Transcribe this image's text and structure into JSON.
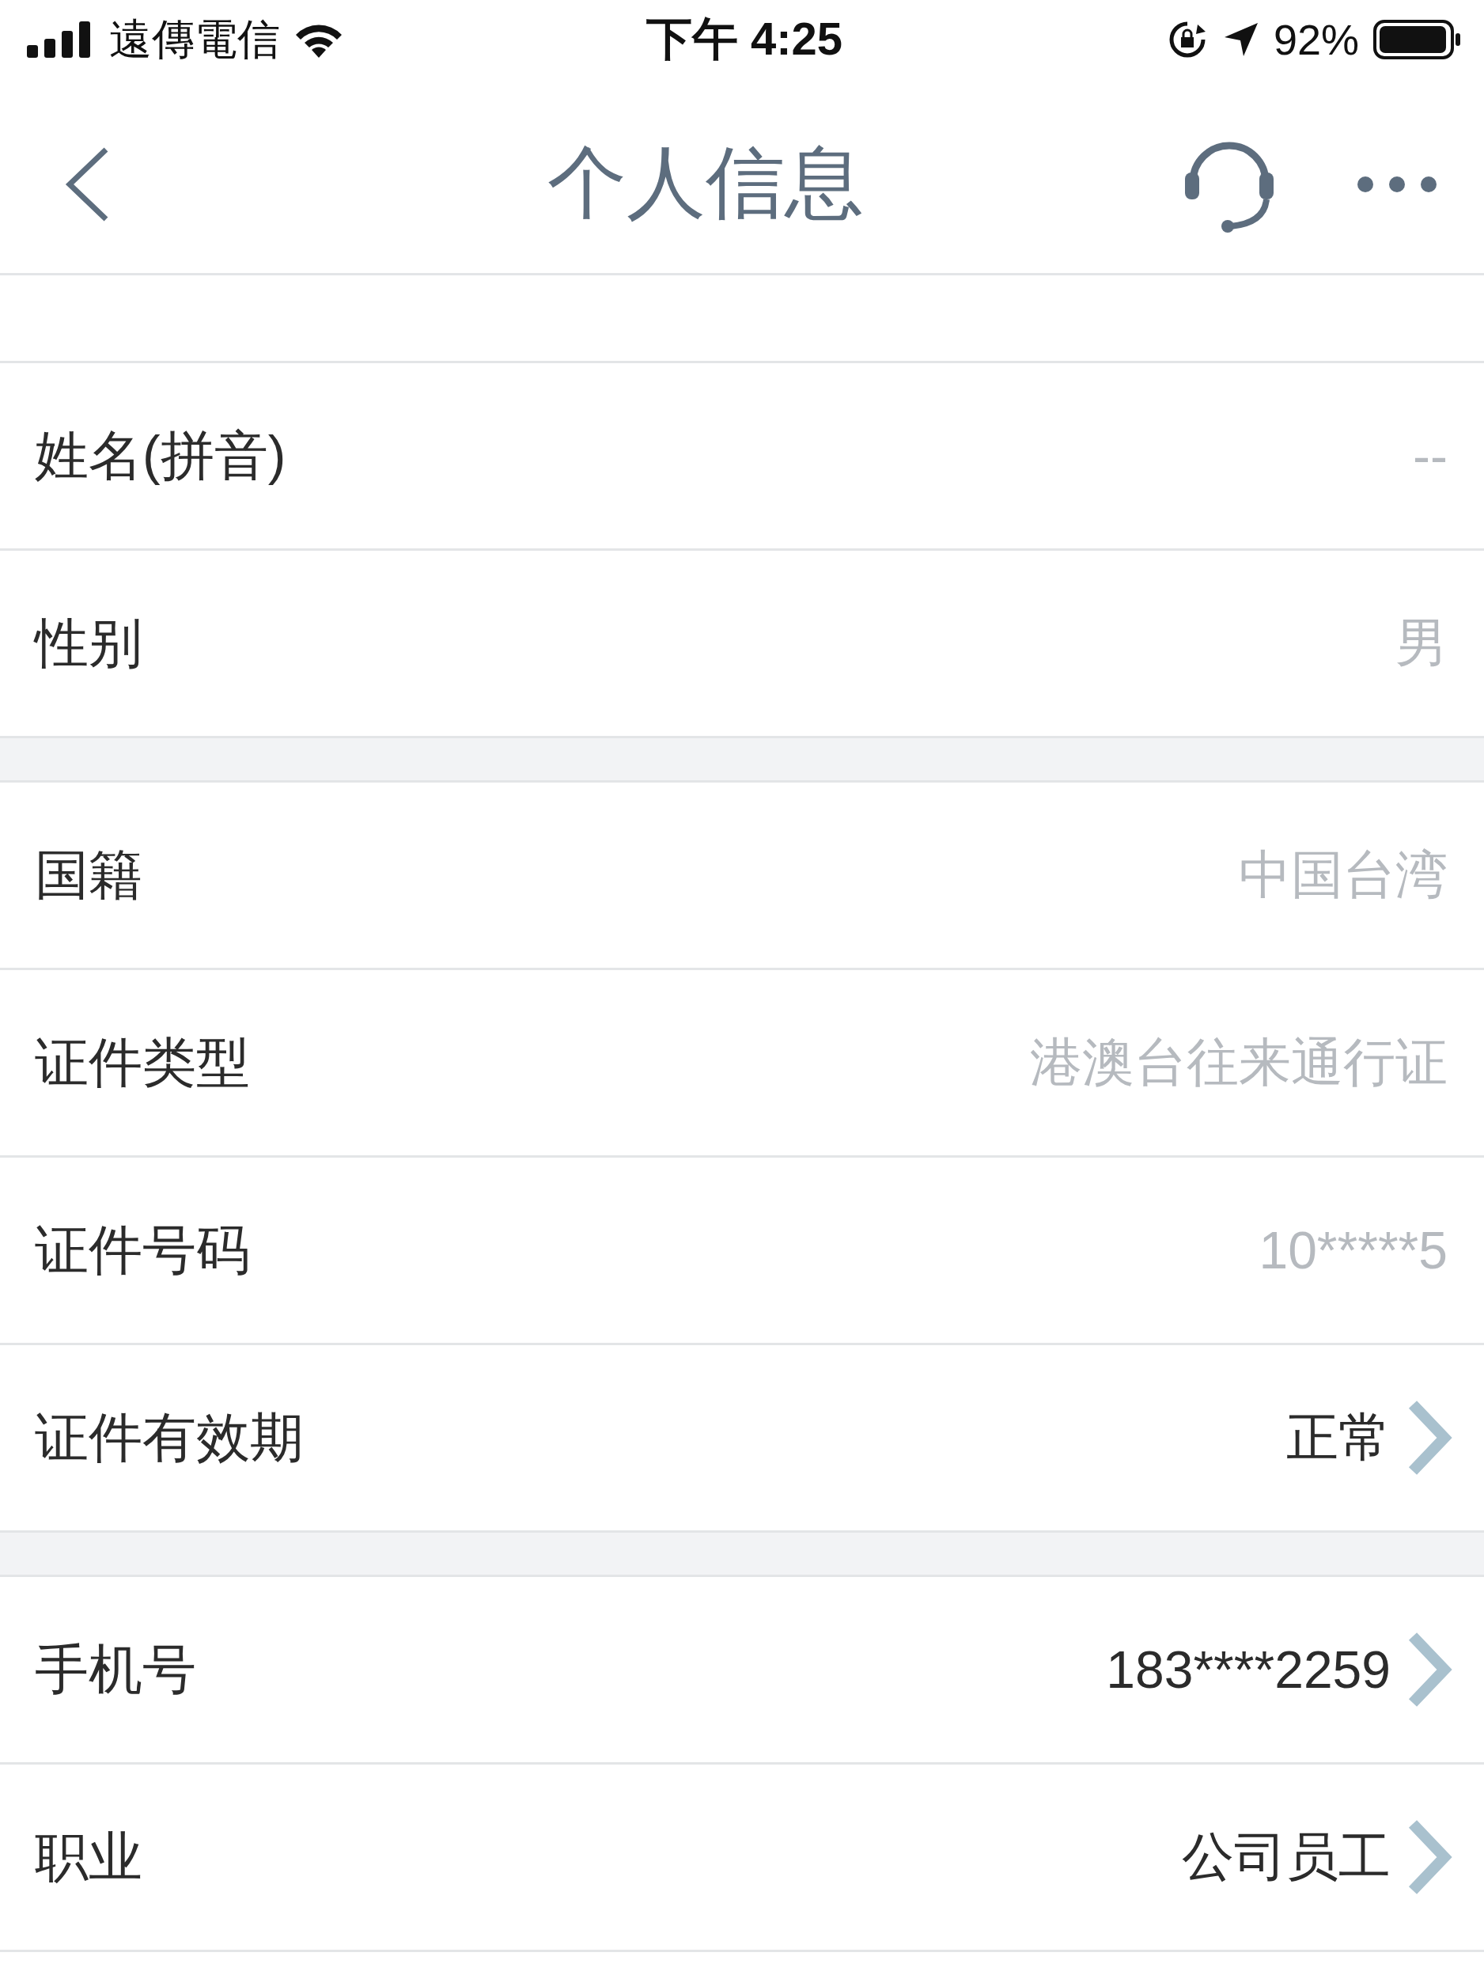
{
  "status_bar": {
    "carrier": "遠傳電信",
    "time": "下午 4:25",
    "battery": "92%"
  },
  "nav_bar": {
    "title": "个人信息"
  },
  "sections": [
    {
      "rows": [
        {
          "label": "姓名(拼音)",
          "value": "--",
          "kind": "info"
        },
        {
          "label": "性别",
          "value": "男",
          "kind": "info"
        }
      ]
    },
    {
      "rows": [
        {
          "label": "国籍",
          "value": "中国台湾",
          "kind": "info"
        },
        {
          "label": "证件类型",
          "value": "港澳台往来通行证",
          "kind": "info"
        },
        {
          "label": "证件号码",
          "value": "10*****5",
          "kind": "info"
        },
        {
          "label": "证件有效期",
          "value": "正常",
          "kind": "link"
        }
      ]
    },
    {
      "rows": [
        {
          "label": "手机号",
          "value": "183****2259",
          "kind": "link"
        },
        {
          "label": "职业",
          "value": "公司员工",
          "kind": "link"
        }
      ]
    }
  ]
}
